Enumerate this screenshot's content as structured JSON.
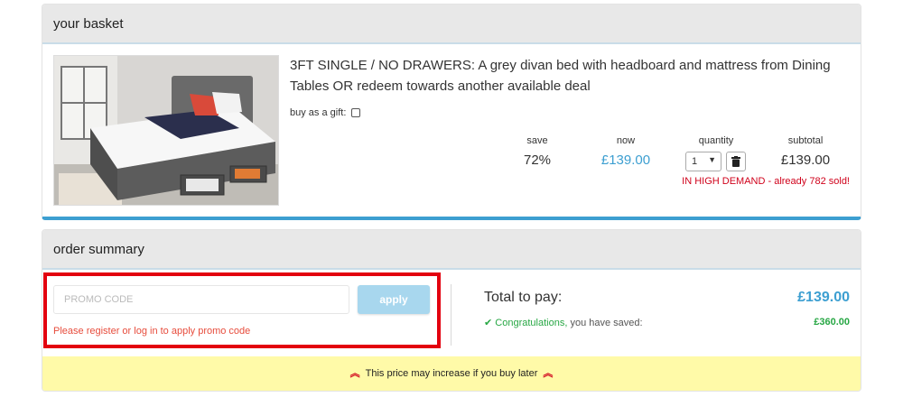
{
  "basket": {
    "title": "your basket",
    "product_title": "3FT SINGLE / NO DRAWERS: A grey divan bed with headboard and mattress from Dining Tables OR redeem towards another available deal",
    "gift_label": "buy as a gift:",
    "headers": {
      "save": "save",
      "now": "now",
      "quantity": "quantity",
      "subtotal": "subtotal"
    },
    "save_value": "72%",
    "now_value": "£139.00",
    "quantity_value": "1",
    "subtotal_value": "£139.00",
    "demand_text": "IN HIGH DEMAND - already 782 sold!",
    "icons": {
      "product_image": "bed-photo",
      "delete": "trash-icon",
      "quantity_dropdown": "caret-down-icon"
    }
  },
  "summary": {
    "title": "order summary",
    "promo_placeholder": "PROMO CODE",
    "apply_label": "apply",
    "promo_error": "Please register or log in to apply promo code",
    "total_label": "Total to pay:",
    "total_value": "£139.00",
    "congrats": "Congratulations,",
    "saved_text": " you have saved:",
    "saved_value": "£360.00",
    "warning": "This price may increase if you buy later"
  },
  "colors": {
    "accent": "#3d9fd1",
    "danger": "#d0021b",
    "success": "#27a744",
    "warning_bg": "#fffaa8",
    "highlight": "#e3000f"
  }
}
